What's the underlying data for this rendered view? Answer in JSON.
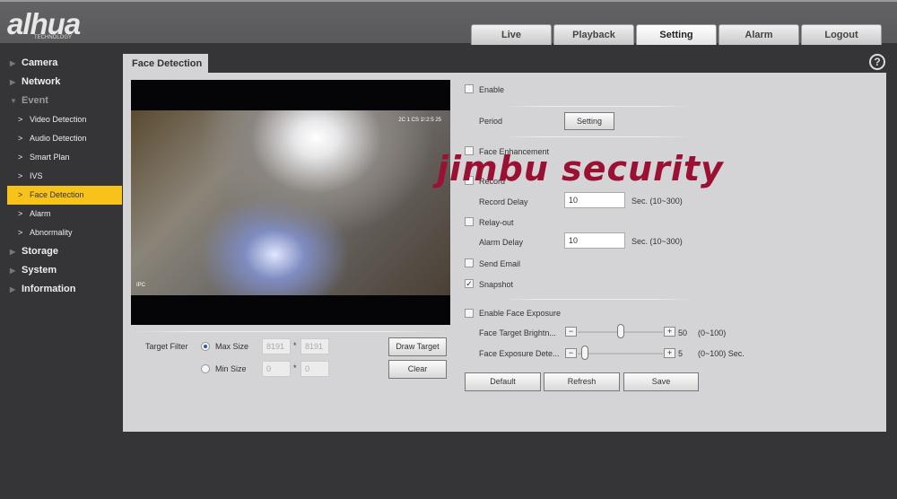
{
  "header": {
    "logo": "alhua",
    "logo_sub": "TECHNOLOGY",
    "tabs": [
      "Live",
      "Playback",
      "Setting",
      "Alarm",
      "Logout"
    ],
    "active_tab": "Setting"
  },
  "sidebar": {
    "items": [
      {
        "label": "Camera",
        "type": "top"
      },
      {
        "label": "Network",
        "type": "top"
      },
      {
        "label": "Event",
        "type": "top-open"
      },
      {
        "label": "Video Detection",
        "type": "sub"
      },
      {
        "label": "Audio Detection",
        "type": "sub"
      },
      {
        "label": "Smart Plan",
        "type": "sub"
      },
      {
        "label": "IVS",
        "type": "sub"
      },
      {
        "label": "Face Detection",
        "type": "sub",
        "selected": true
      },
      {
        "label": "Alarm",
        "type": "sub"
      },
      {
        "label": "Abnormality",
        "type": "sub"
      },
      {
        "label": "Storage",
        "type": "top"
      },
      {
        "label": "System",
        "type": "top"
      },
      {
        "label": "Information",
        "type": "top"
      }
    ]
  },
  "page": {
    "tab": "Face Detection",
    "help": "?"
  },
  "video": {
    "osd_time": "2C 1 CS 1!:2:5 25",
    "osd_label": "IPC"
  },
  "filter": {
    "label": "Target Filter",
    "max_label": "Max Size",
    "max_w": "8191",
    "max_h": "8191",
    "min_label": "Min Size",
    "min_w": "0",
    "min_h": "0",
    "sep": "*",
    "draw": "Draw Target",
    "clear": "Clear",
    "selected": "Max Size"
  },
  "settings": {
    "enable": "Enable",
    "enable_checked": false,
    "period": "Period",
    "period_btn": "Setting",
    "face_enh": "Face Enhancement",
    "face_enh_checked": false,
    "record": "Record",
    "record_checked": false,
    "record_delay": "Record Delay",
    "record_delay_val": "10",
    "record_unit": "Sec. (10~300)",
    "relay": "Relay-out",
    "relay_checked": false,
    "alarm_delay": "Alarm Delay",
    "alarm_delay_val": "10",
    "alarm_unit": "Sec. (10~300)",
    "email": "Send Email",
    "email_checked": false,
    "snapshot": "Snapshot",
    "snapshot_checked": true,
    "check_mark": "✓",
    "exposure": "Enable Face Exposure",
    "exposure_checked": false,
    "brightness": "Face Target Brightn...",
    "brightness_val": "50",
    "brightness_range": "(0~100)",
    "brightness_level": 50,
    "detect": "Face Exposure Dete...",
    "detect_val": "5",
    "detect_range": "(0~100) Sec.",
    "detect_level": 5,
    "minus": "−",
    "plus": "+"
  },
  "actions": {
    "default": "Default",
    "refresh": "Refresh",
    "save": "Save"
  },
  "watermark": "jimbu security"
}
